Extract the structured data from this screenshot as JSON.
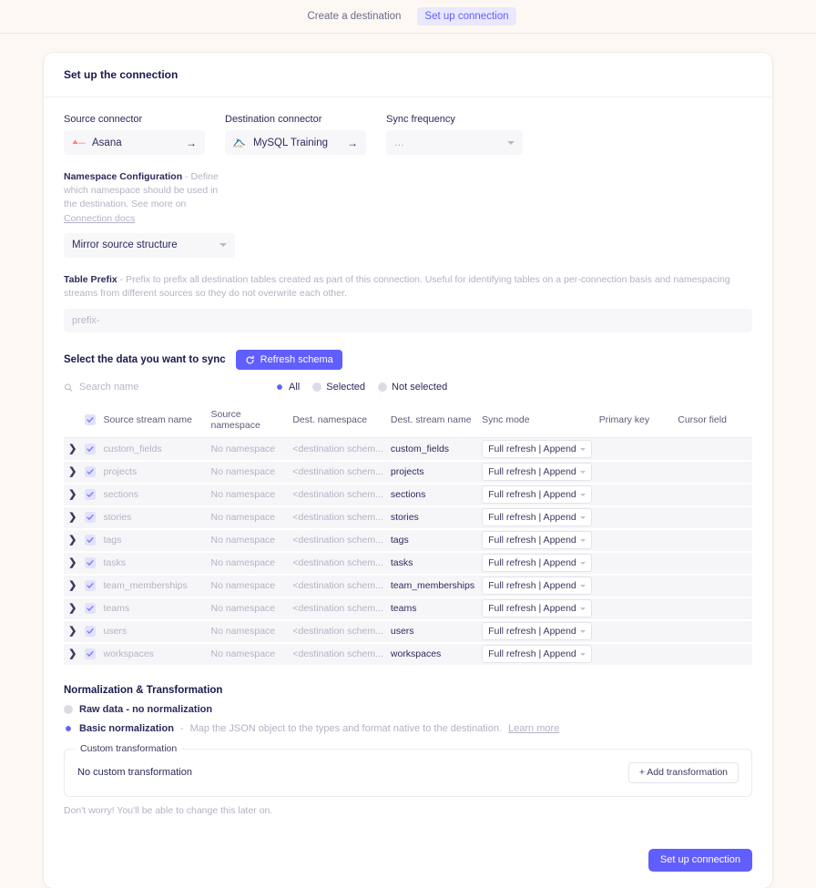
{
  "steps": [
    {
      "label": "Create a destination",
      "active": false
    },
    {
      "label": "Set up connection",
      "active": true
    }
  ],
  "card": {
    "title": "Set up the connection"
  },
  "connectors": {
    "source": {
      "label": "Source connector",
      "name": "Asana",
      "logo": "asana-logo",
      "arrow": "→"
    },
    "destination": {
      "label": "Destination connector",
      "name": "MySQL Training",
      "logo": "mysql-logo",
      "arrow": "→"
    },
    "frequency": {
      "label": "Sync frequency",
      "value": "..."
    }
  },
  "namespace": {
    "title": "Namespace Configuration",
    "dash": "-",
    "description": "Define which namespace should be used in the destination. See more on",
    "link": "Connection docs",
    "value": "Mirror source structure"
  },
  "table_prefix": {
    "title": "Table Prefix",
    "dash": "-",
    "description": "Prefix to prefix all destination tables created as part of this connection. Useful for identifying tables on a per-connection basis and namespacing streams from different sources so they do not overwrite each other.",
    "placeholder": "prefix-",
    "value": ""
  },
  "schema": {
    "title": "Select the data you want to sync",
    "refresh_label": "Refresh schema",
    "search_placeholder": "Search name",
    "search_value": "",
    "filters": [
      {
        "label": "All",
        "selected": true
      },
      {
        "label": "Selected",
        "selected": false
      },
      {
        "label": "Not selected",
        "selected": false
      }
    ],
    "columns": [
      "Source stream name",
      "Source namespace",
      "Dest. namespace",
      "Dest. stream name",
      "Sync mode",
      "Primary key",
      "Cursor field"
    ],
    "rows": [
      {
        "source_stream": "custom_fields",
        "source_namespace": "No namespace",
        "dest_namespace": "<destination schem...",
        "dest_stream": "custom_fields",
        "sync_mode": "Full refresh | Append",
        "primary_key": "",
        "cursor_field": "",
        "checked": true
      },
      {
        "source_stream": "projects",
        "source_namespace": "No namespace",
        "dest_namespace": "<destination schem...",
        "dest_stream": "projects",
        "sync_mode": "Full refresh | Append",
        "primary_key": "",
        "cursor_field": "",
        "checked": true
      },
      {
        "source_stream": "sections",
        "source_namespace": "No namespace",
        "dest_namespace": "<destination schem...",
        "dest_stream": "sections",
        "sync_mode": "Full refresh | Append",
        "primary_key": "",
        "cursor_field": "",
        "checked": true
      },
      {
        "source_stream": "stories",
        "source_namespace": "No namespace",
        "dest_namespace": "<destination schem...",
        "dest_stream": "stories",
        "sync_mode": "Full refresh | Append",
        "primary_key": "",
        "cursor_field": "",
        "checked": true
      },
      {
        "source_stream": "tags",
        "source_namespace": "No namespace",
        "dest_namespace": "<destination schem...",
        "dest_stream": "tags",
        "sync_mode": "Full refresh | Append",
        "primary_key": "",
        "cursor_field": "",
        "checked": true
      },
      {
        "source_stream": "tasks",
        "source_namespace": "No namespace",
        "dest_namespace": "<destination schem...",
        "dest_stream": "tasks",
        "sync_mode": "Full refresh | Append",
        "primary_key": "",
        "cursor_field": "",
        "checked": true
      },
      {
        "source_stream": "team_memberships",
        "source_namespace": "No namespace",
        "dest_namespace": "<destination schem...",
        "dest_stream": "team_memberships",
        "sync_mode": "Full refresh | Append",
        "primary_key": "",
        "cursor_field": "",
        "checked": true
      },
      {
        "source_stream": "teams",
        "source_namespace": "No namespace",
        "dest_namespace": "<destination schem...",
        "dest_stream": "teams",
        "sync_mode": "Full refresh | Append",
        "primary_key": "",
        "cursor_field": "",
        "checked": true
      },
      {
        "source_stream": "users",
        "source_namespace": "No namespace",
        "dest_namespace": "<destination schem...",
        "dest_stream": "users",
        "sync_mode": "Full refresh | Append",
        "primary_key": "",
        "cursor_field": "",
        "checked": true
      },
      {
        "source_stream": "workspaces",
        "source_namespace": "No namespace",
        "dest_namespace": "<destination schem...",
        "dest_stream": "workspaces",
        "sync_mode": "Full refresh | Append",
        "primary_key": "",
        "cursor_field": "",
        "checked": true
      }
    ]
  },
  "normalization": {
    "title": "Normalization & Transformation",
    "raw": {
      "label": "Raw data - no normalization",
      "selected": false
    },
    "basic": {
      "label": "Basic normalization",
      "dash": "-",
      "description": "Map the JSON object to the types and format native to the destination.",
      "link": "Learn more",
      "selected": true
    },
    "custom": {
      "legend": "Custom transformation",
      "empty_text": "No custom transformation",
      "add_label": "+ Add transformation"
    },
    "footnote": "Don't worry! You'll be able to change this later on."
  },
  "footer": {
    "submit_label": "Set up connection"
  },
  "colors": {
    "accent": "#615eff",
    "accent_soft": "#e9e8ff",
    "page_bg": "#fdf8f4",
    "field_bg": "#f7f7fa",
    "row_bg": "#f6f6f9",
    "muted_text": "#b4b2c4",
    "heading_text": "#1a194d"
  }
}
